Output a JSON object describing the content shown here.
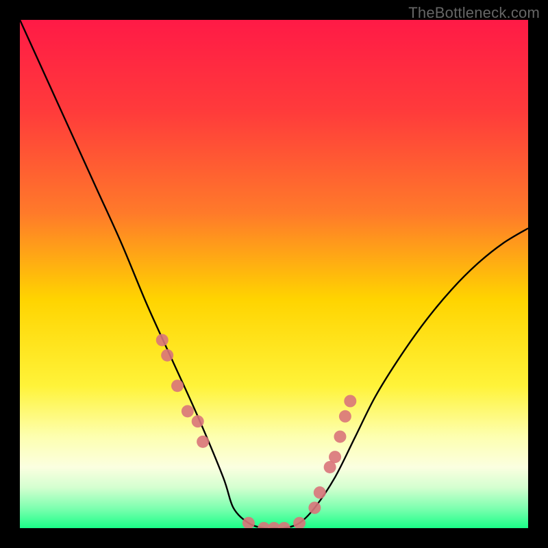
{
  "watermark": "TheBottleneck.com",
  "chart_data": {
    "type": "line",
    "title": "",
    "xlabel": "",
    "ylabel": "",
    "xlim": [
      0,
      100
    ],
    "ylim": [
      0,
      100
    ],
    "series": [
      {
        "name": "bottleneck-curve",
        "x": [
          0,
          5,
          10,
          15,
          20,
          25,
          30,
          35,
          40,
          42,
          45,
          48,
          50,
          52,
          55,
          58,
          62,
          66,
          70,
          75,
          80,
          85,
          90,
          95,
          100
        ],
        "y": [
          100,
          89,
          78,
          67,
          56,
          44,
          33,
          22,
          10,
          4,
          1,
          0,
          0,
          0,
          1,
          4,
          10,
          18,
          26,
          34,
          41,
          47,
          52,
          56,
          59
        ]
      }
    ],
    "markers": {
      "name": "highlight-points",
      "x": [
        28,
        29,
        31,
        33,
        35,
        36,
        45,
        48,
        50,
        52,
        55,
        58,
        59,
        61,
        62,
        63,
        64,
        65
      ],
      "y": [
        37,
        34,
        28,
        23,
        21,
        17,
        1,
        0,
        0,
        0,
        1,
        4,
        7,
        12,
        14,
        18,
        22,
        25
      ]
    },
    "gradient_stops": [
      {
        "pct": 0,
        "color": "#ff1a46"
      },
      {
        "pct": 18,
        "color": "#ff3b3b"
      },
      {
        "pct": 38,
        "color": "#ff7a2a"
      },
      {
        "pct": 55,
        "color": "#ffd400"
      },
      {
        "pct": 72,
        "color": "#fff339"
      },
      {
        "pct": 82,
        "color": "#fdffb0"
      },
      {
        "pct": 88,
        "color": "#fbffe0"
      },
      {
        "pct": 92,
        "color": "#d4ffd0"
      },
      {
        "pct": 96,
        "color": "#7fffb0"
      },
      {
        "pct": 100,
        "color": "#1aff88"
      }
    ]
  }
}
